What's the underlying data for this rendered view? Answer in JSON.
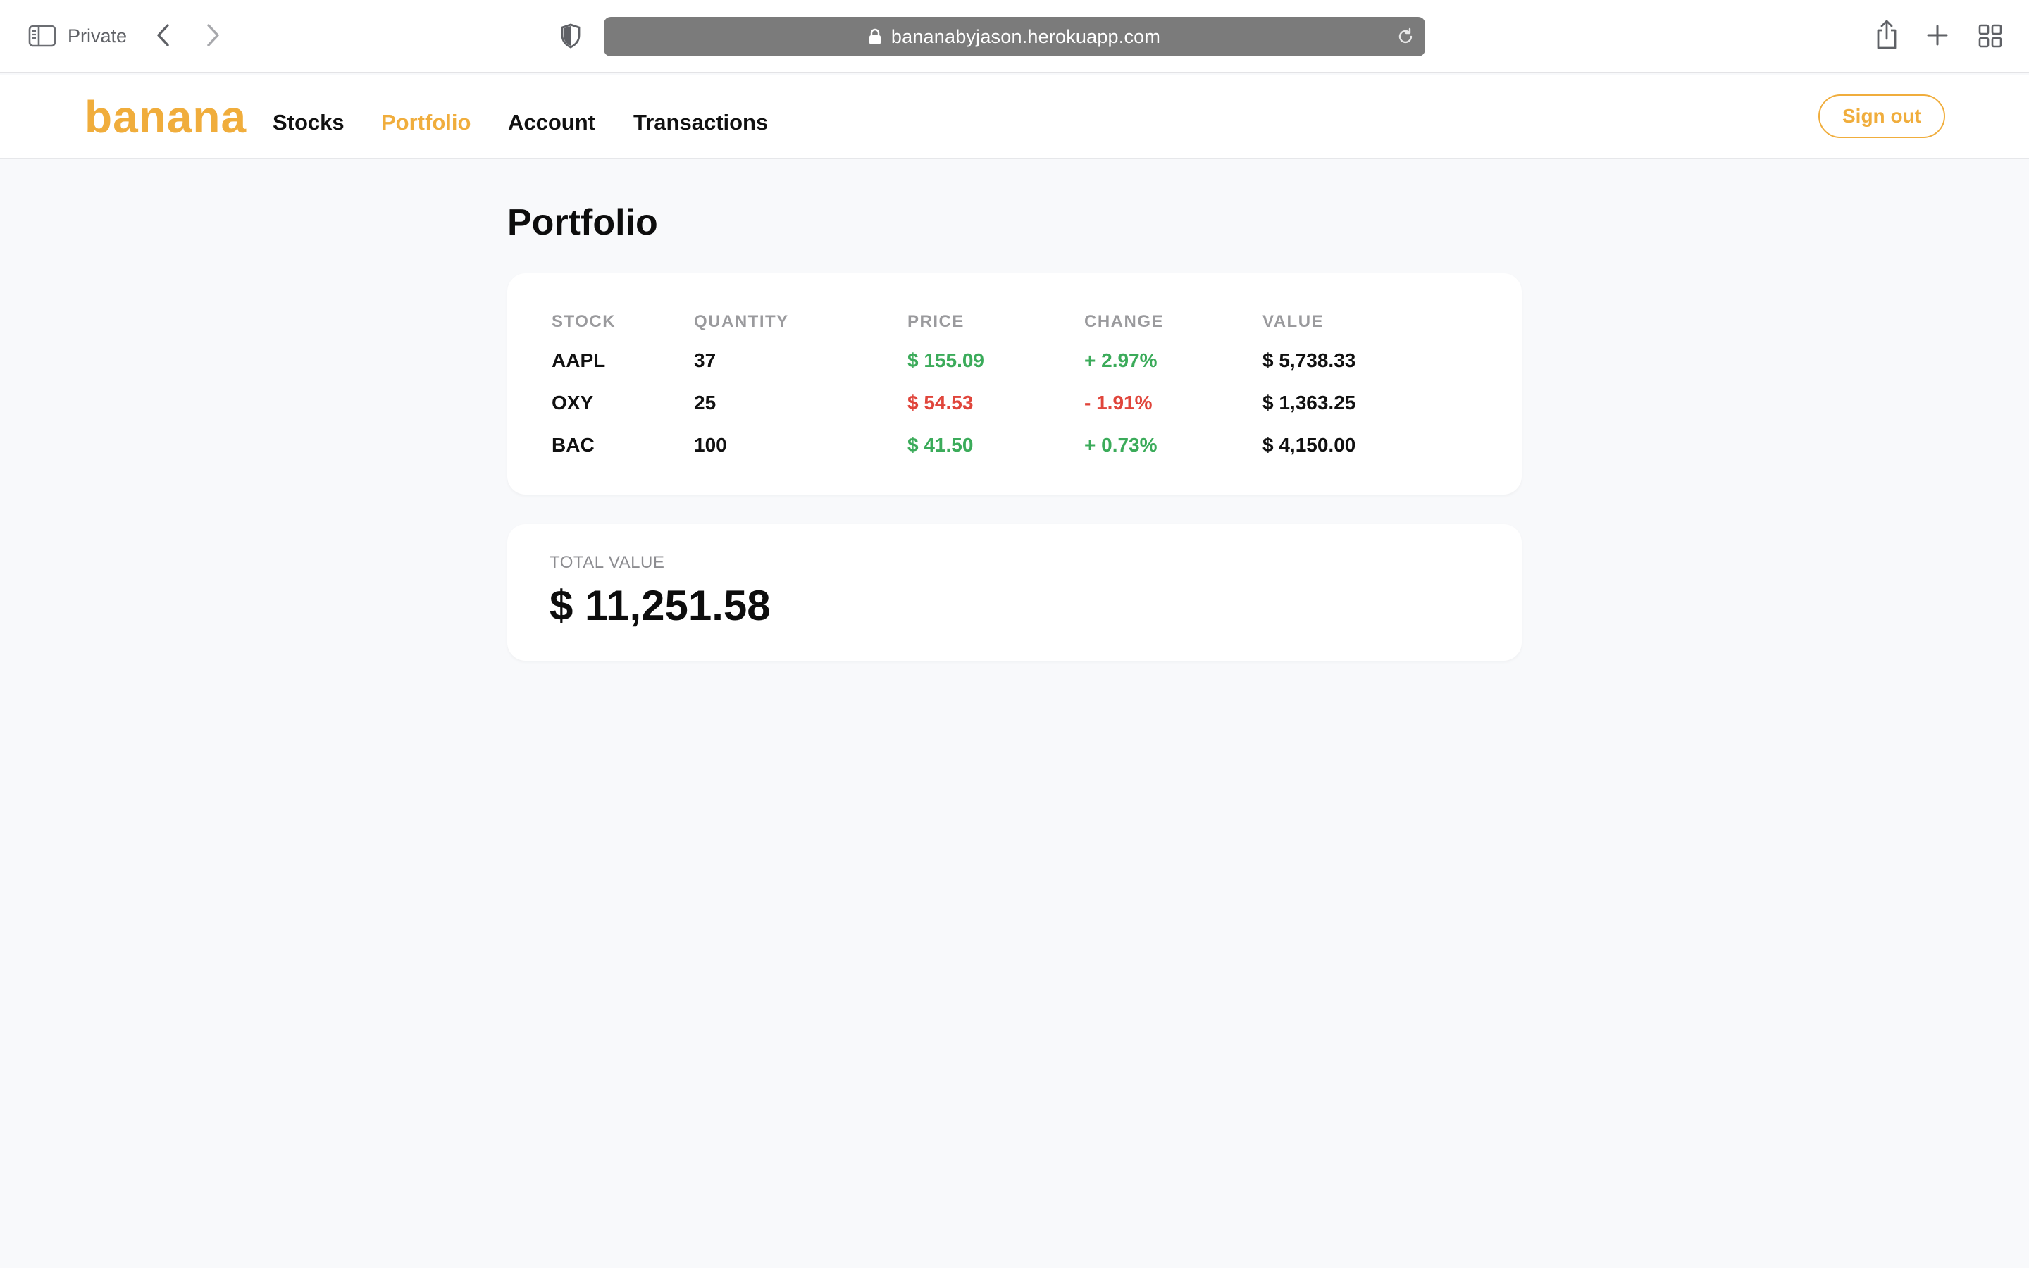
{
  "browser": {
    "private_label": "Private",
    "url": "bananabyjason.herokuapp.com",
    "icons": {
      "sidebar": "sidebar-icon",
      "back": "chevron-left-icon",
      "forward": "chevron-right-icon",
      "privacy": "privacy-shield-icon",
      "lock": "lock-icon",
      "reload": "reload-icon",
      "share": "share-icon",
      "new_tab": "plus-icon",
      "tab_overview": "grid-icon"
    }
  },
  "nav": {
    "logo": "banana",
    "links": [
      {
        "label": "Stocks",
        "active": false
      },
      {
        "label": "Portfolio",
        "active": true
      },
      {
        "label": "Account",
        "active": false
      },
      {
        "label": "Transactions",
        "active": false
      }
    ],
    "sign_out": "Sign out"
  },
  "portfolio": {
    "title": "Portfolio",
    "headers": {
      "stock": "STOCK",
      "quantity": "QUANTITY",
      "price": "PRICE",
      "change": "CHANGE",
      "value": "VALUE"
    },
    "rows": [
      {
        "stock": "AAPL",
        "quantity": "37",
        "price": "$ 155.09",
        "change": "+ 2.97%",
        "value": "$ 5,738.33",
        "trend": "up"
      },
      {
        "stock": "OXY",
        "quantity": "25",
        "price": "$ 54.53",
        "change": "- 1.91%",
        "value": "$ 1,363.25",
        "trend": "down"
      },
      {
        "stock": "BAC",
        "quantity": "100",
        "price": "$ 41.50",
        "change": "+ 0.73%",
        "value": "$ 4,150.00",
        "trend": "up"
      }
    ],
    "total_label": "TOTAL VALUE",
    "total_value": "$ 11,251.58"
  },
  "colors": {
    "brand": "#f0ad3c",
    "positive": "#3bab5a",
    "negative": "#e0453b",
    "background": "#f8f9fb",
    "url_bar": "#7b7b7b"
  }
}
